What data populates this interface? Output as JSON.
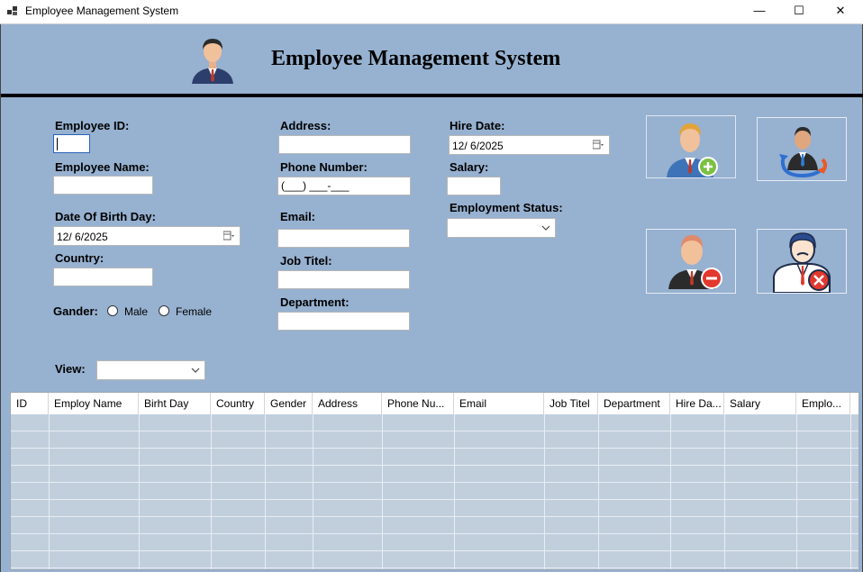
{
  "window": {
    "title": "Employee Management System",
    "minimize_glyph": "—",
    "maximize_glyph": "☐",
    "close_glyph": "✕"
  },
  "header": {
    "title": "Employee Management System",
    "avatar_icon": "businessman-icon"
  },
  "form": {
    "employee_id_label": "Employee ID:",
    "employee_id_value": "",
    "employee_name_label": "Employee Name:",
    "employee_name_value": "",
    "dob_label": "Date Of Birth Day:",
    "dob_value": "12/  6/2025",
    "country_label": "Country:",
    "country_value": "",
    "gender_label": "Gander:",
    "gender_male": "Male",
    "gender_female": "Female",
    "address_label": "Address:",
    "address_value": "",
    "phone_label": "Phone Number:",
    "phone_value": "(___) ___-___",
    "email_label": "Email:",
    "email_value": "",
    "job_label": "Job Titel:",
    "job_value": "",
    "department_label": "Department:",
    "department_value": "",
    "hire_label": "Hire Date:",
    "hire_value": "12/  6/2025",
    "salary_label": "Salary:",
    "salary_value": "",
    "status_label": "Employment Status:",
    "status_value": "",
    "view_label": "View:",
    "view_value": ""
  },
  "actions": {
    "add_icon": "add-employee-icon",
    "update_icon": "update-employee-icon",
    "delete_icon": "delete-employee-icon",
    "clear_icon": "cancel-employee-icon"
  },
  "grid": {
    "columns": [
      "ID",
      "Employ Name",
      "Birht Day",
      "Country",
      "Gender",
      "Address",
      "Phone Nu...",
      "Email",
      "Job Titel",
      "Department",
      "Hire Da...",
      "Salary",
      "Emplo..."
    ]
  },
  "colors": {
    "background": "#97b1d0",
    "grid_background": "#c1cfdd"
  }
}
